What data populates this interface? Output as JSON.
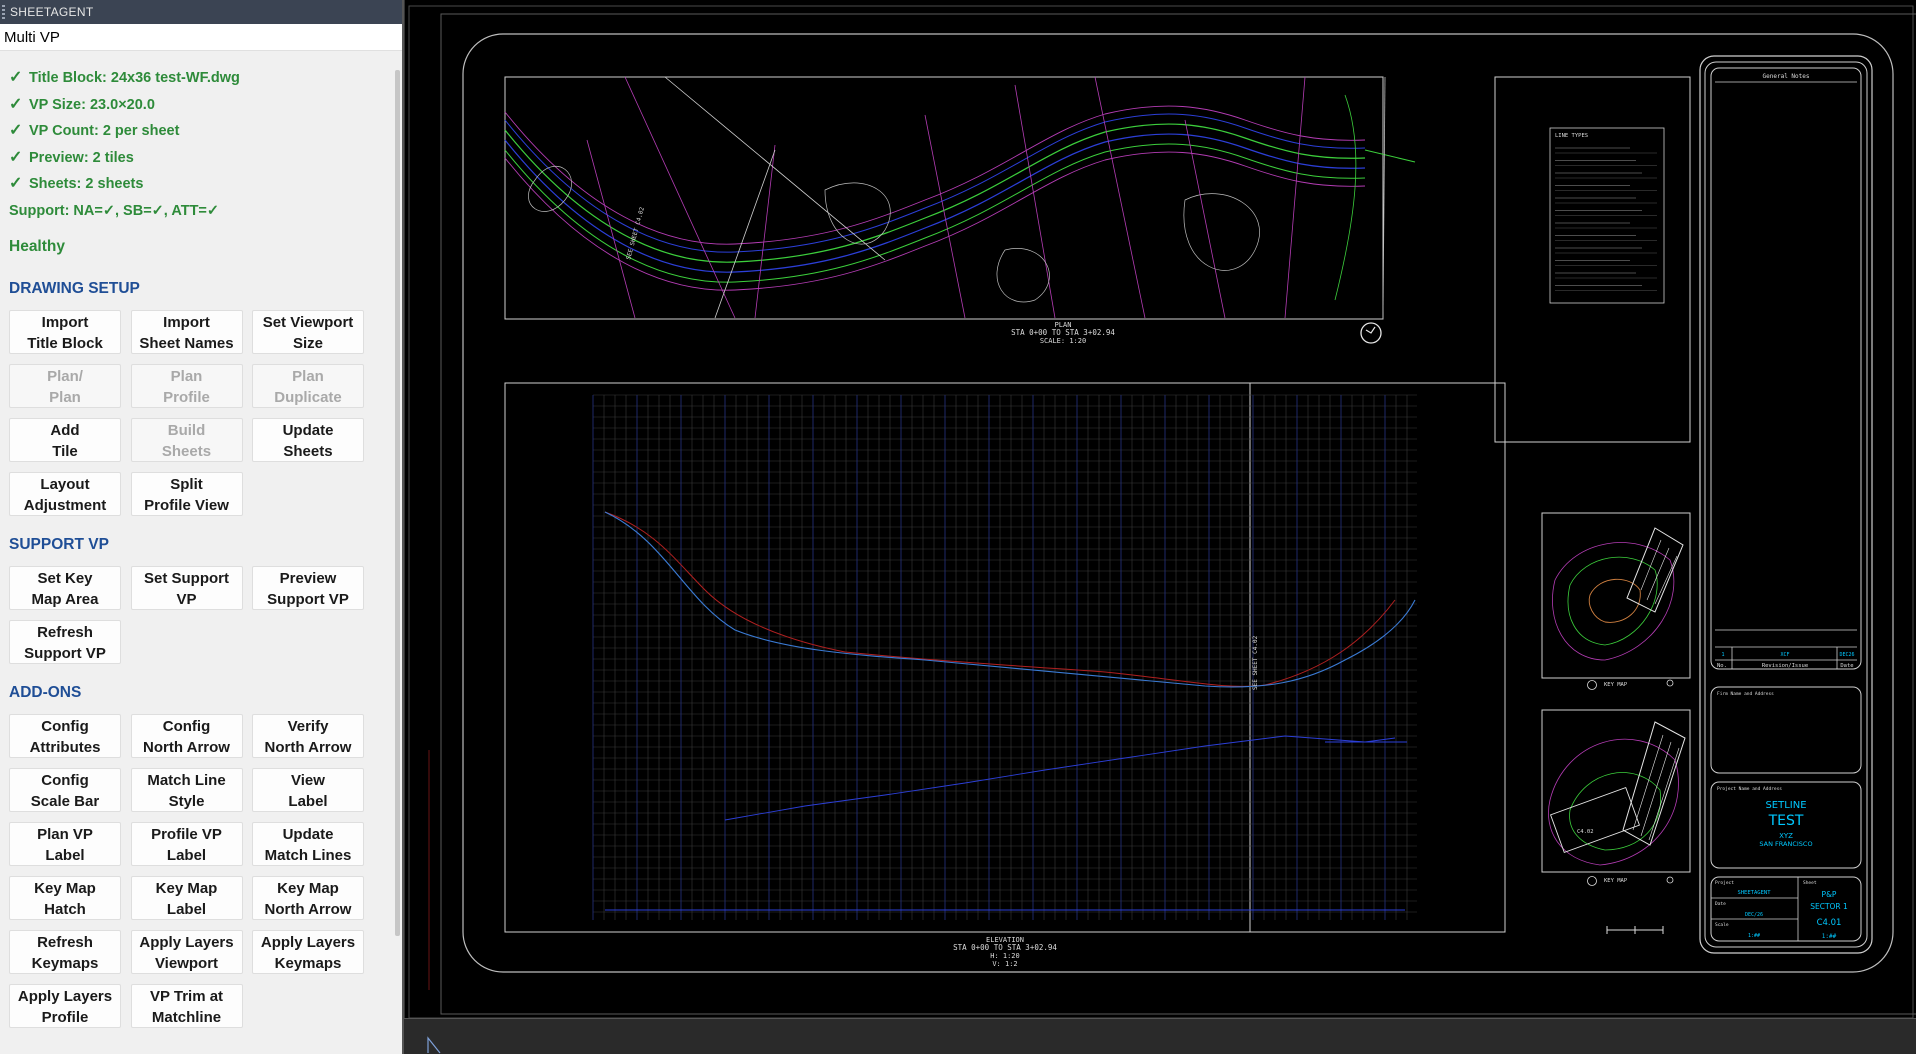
{
  "palette": {
    "title": "SHEETAGENT",
    "tab": "Multi VP",
    "checks": [
      {
        "mark": "✓",
        "text": "Title Block: 24x36 test-WF.dwg"
      },
      {
        "mark": "✓",
        "text": "VP Size: 23.0×20.0"
      },
      {
        "mark": "✓",
        "text": "VP Count: 2 per sheet"
      },
      {
        "mark": "✓",
        "text": "Preview: 2 tiles"
      },
      {
        "mark": "✓",
        "text": "Sheets: 2 sheets"
      }
    ],
    "support": "Support:  NA=✓, SB=✓, ATT=✓",
    "health": "Healthy",
    "sections": [
      {
        "title": "DRAWING SETUP",
        "buttons": [
          {
            "label": "Import\nTitle Block",
            "enabled": true
          },
          {
            "label": "Import\nSheet Names",
            "enabled": true
          },
          {
            "label": "Set Viewport\nSize",
            "enabled": true
          },
          {
            "label": "Plan/\nPlan",
            "enabled": false
          },
          {
            "label": "Plan\nProfile",
            "enabled": false
          },
          {
            "label": "Plan\nDuplicate",
            "enabled": false
          },
          {
            "label": "Add\nTile",
            "enabled": true
          },
          {
            "label": "Build\nSheets",
            "enabled": false
          },
          {
            "label": "Update\nSheets",
            "enabled": true
          },
          {
            "label": "Layout\nAdjustment",
            "enabled": true
          },
          {
            "label": "Split\nProfile View",
            "enabled": true
          }
        ]
      },
      {
        "title": "SUPPORT VP",
        "buttons": [
          {
            "label": "Set Key\nMap Area",
            "enabled": true
          },
          {
            "label": "Set Support\nVP",
            "enabled": true
          },
          {
            "label": "Preview\nSupport VP",
            "enabled": true
          },
          {
            "label": "Refresh\nSupport VP",
            "enabled": true
          }
        ]
      },
      {
        "title": "ADD-ONS",
        "buttons": [
          {
            "label": "Config\nAttributes",
            "enabled": true
          },
          {
            "label": "Config\nNorth Arrow",
            "enabled": true
          },
          {
            "label": "Verify\nNorth Arrow",
            "enabled": true
          },
          {
            "label": "Config\nScale Bar",
            "enabled": true
          },
          {
            "label": "Match Line\nStyle",
            "enabled": true
          },
          {
            "label": "View\nLabel",
            "enabled": true
          },
          {
            "label": "Plan VP\nLabel",
            "enabled": true
          },
          {
            "label": "Profile VP\nLabel",
            "enabled": true
          },
          {
            "label": "Update\nMatch Lines",
            "enabled": true
          },
          {
            "label": "Key Map\nHatch",
            "enabled": true
          },
          {
            "label": "Key Map\nLabel",
            "enabled": true
          },
          {
            "label": "Key Map\nNorth Arrow",
            "enabled": true
          },
          {
            "label": "Refresh\nKeymaps",
            "enabled": true
          },
          {
            "label": "Apply Layers\nViewport",
            "enabled": true
          },
          {
            "label": "Apply Layers\nKeymaps",
            "enabled": true
          },
          {
            "label": "Apply Layers\nProfile",
            "enabled": true
          },
          {
            "label": "VP Trim at\nMatchline",
            "enabled": true
          }
        ]
      }
    ]
  },
  "drawing": {
    "plan_title": "PLAN",
    "plan_sta": "STA 0+00 TO STA 3+02.94",
    "plan_scale": "SCALE: 1:20",
    "elev_title": "ELEVATION",
    "elev_sta": "STA 0+00 TO STA 3+02.94",
    "elev_h": "H: 1:20",
    "elev_v": "V: 1:2",
    "match_plan": "SEE SHEET C4.02",
    "match_profile": "SEE SHEET C4.02",
    "general_notes": "General Notes",
    "line_types": "LINE TYPES",
    "key_map_1": "KEY MAP",
    "key_map_2": "KEY MAP",
    "rev_no_val": "1",
    "rev_issue_val": "XCF",
    "rev_date_val": "DEC26",
    "rev_no": "No.",
    "rev_issue": "Revision/Issue",
    "rev_date": "Date",
    "firm_label": "Firm Name and Address",
    "project_label": "Project Name and Address",
    "project_name_1": "SETLINE",
    "project_name_2": "TEST",
    "project_city_1": "XYZ",
    "project_city_2": "SAN FRANCISCO",
    "tb_project_label": "Project",
    "tb_project": "SHEETAGENT",
    "tb_sheet_label": "Sheet",
    "tb_sheet_1": "P&P",
    "tb_sheet_2": "SECTOR 1",
    "tb_sheet_num": "C4.01",
    "tb_date_label": "Date",
    "tb_date": "DEC/26",
    "tb_scale_label": "Scale",
    "tb_scale": "1:##",
    "km_label": "C4.02"
  },
  "colors": {
    "accent": "#1f4e96",
    "ok": "#2e8b3a",
    "cad_cyan": "#00c8ff",
    "cad_green": "#3ccf3c",
    "cad_magenta": "#b43cb4",
    "cad_blue": "#2c3fd8",
    "cad_red": "#b02020"
  }
}
